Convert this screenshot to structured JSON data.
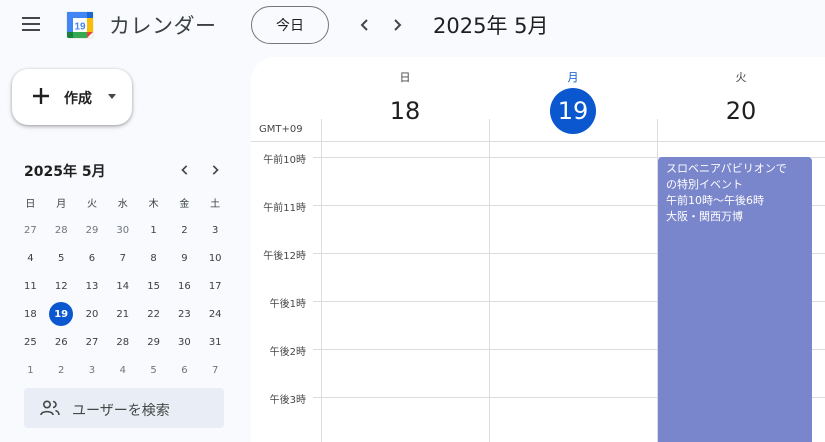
{
  "header": {
    "app_title": "カレンダー",
    "logo_day": "19",
    "today_label": "今日",
    "period_title": "2025年 5月"
  },
  "create": {
    "label": "作成"
  },
  "mini_calendar": {
    "title": "2025年 5月",
    "weekday_headers": [
      "日",
      "月",
      "火",
      "水",
      "木",
      "金",
      "土"
    ],
    "weeks": [
      [
        "27",
        "28",
        "29",
        "30",
        "1",
        "2",
        "3"
      ],
      [
        "4",
        "5",
        "6",
        "7",
        "8",
        "9",
        "10"
      ],
      [
        "11",
        "12",
        "13",
        "14",
        "15",
        "16",
        "17"
      ],
      [
        "18",
        "19",
        "20",
        "21",
        "22",
        "23",
        "24"
      ],
      [
        "25",
        "26",
        "27",
        "28",
        "29",
        "30",
        "31"
      ],
      [
        "1",
        "2",
        "3",
        "4",
        "5",
        "6",
        "7"
      ]
    ],
    "selected": "19"
  },
  "search_users": {
    "label": "ユーザーを検索"
  },
  "week_view": {
    "timezone": "GMT+09",
    "days": [
      {
        "dow": "日",
        "num": "18",
        "active": false
      },
      {
        "dow": "月",
        "num": "19",
        "active": true
      },
      {
        "dow": "火",
        "num": "20",
        "active": false
      }
    ],
    "hours": [
      "午前10時",
      "午前11時",
      "午後12時",
      "午後1時",
      "午後2時",
      "午後3時"
    ]
  },
  "event": {
    "title_line1": "スロベニアパビリオンで",
    "title_line2": "の特別イベント",
    "time": "午前10時～午後6時",
    "location": "大阪・関西万博",
    "color": "#7986cb"
  },
  "colors": {
    "accent": "#0b57d0",
    "event": "#7986cb"
  }
}
